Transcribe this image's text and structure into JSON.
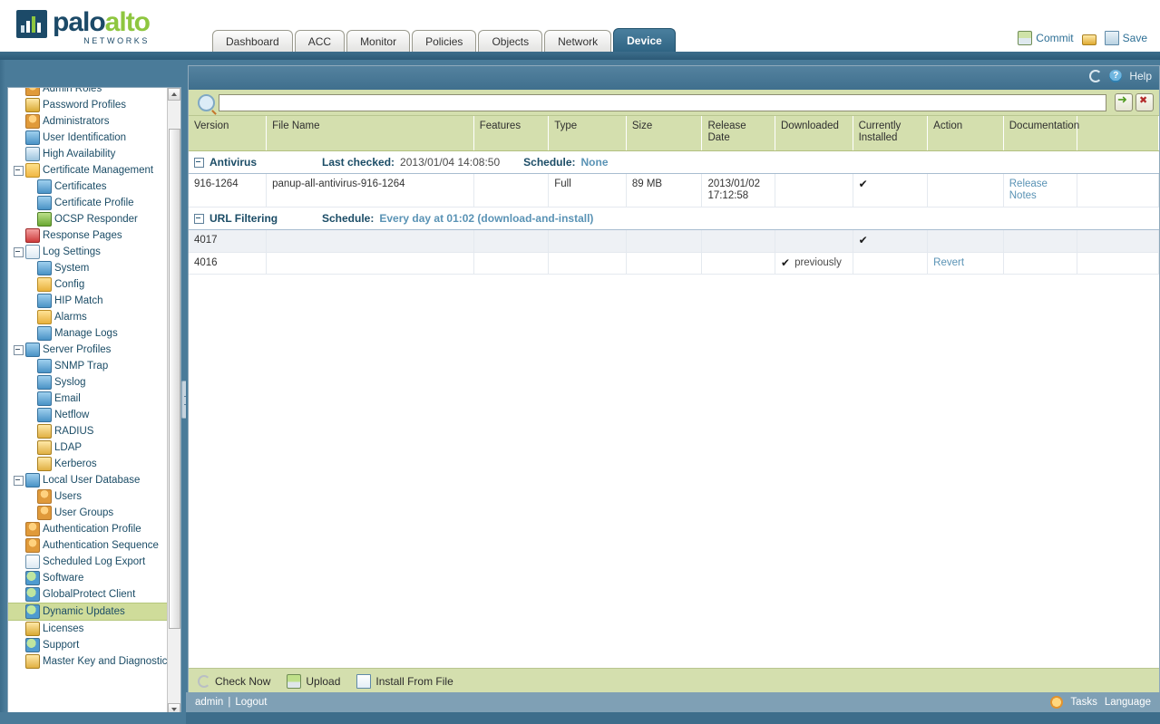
{
  "brand": {
    "name_part1": "palo",
    "name_part2": "alto",
    "tagline": "NETWORKS"
  },
  "tabs": [
    {
      "label": "Dashboard",
      "active": false
    },
    {
      "label": "ACC",
      "active": false
    },
    {
      "label": "Monitor",
      "active": false
    },
    {
      "label": "Policies",
      "active": false
    },
    {
      "label": "Objects",
      "active": false
    },
    {
      "label": "Network",
      "active": false
    },
    {
      "label": "Device",
      "active": true
    }
  ],
  "header_actions": {
    "commit": "Commit",
    "save": "Save",
    "lock_icon": "padlock-icon"
  },
  "panel_topbar": {
    "refresh_icon": "refresh-icon",
    "help": "Help",
    "help_icon": "help-icon"
  },
  "search": {
    "value": "",
    "placeholder": "",
    "icon": "search-icon",
    "apply_icon": "green-arrow-icon",
    "clear_icon": "red-x-icon"
  },
  "sidebar": {
    "items": [
      {
        "label": "Admin Roles",
        "level": 1,
        "icon": "admin-roles-icon",
        "expander": false,
        "selected": false
      },
      {
        "label": "Password Profiles",
        "level": 1,
        "icon": "key-icon",
        "expander": false,
        "selected": false
      },
      {
        "label": "Administrators",
        "level": 1,
        "icon": "user-icon",
        "expander": false,
        "selected": false
      },
      {
        "label": "User Identification",
        "level": 1,
        "icon": "id-card-icon",
        "expander": false,
        "selected": false
      },
      {
        "label": "High Availability",
        "level": 1,
        "icon": "ha-icon",
        "expander": false,
        "selected": false
      },
      {
        "label": "Certificate Management",
        "level": 0,
        "icon": "folder-icon",
        "expander": true,
        "selected": false
      },
      {
        "label": "Certificates",
        "level": 2,
        "icon": "certificate-icon",
        "expander": false,
        "selected": false
      },
      {
        "label": "Certificate Profile",
        "level": 2,
        "icon": "certificate-icon",
        "expander": false,
        "selected": false
      },
      {
        "label": "OCSP Responder",
        "level": 2,
        "icon": "ocsp-icon",
        "expander": false,
        "selected": false
      },
      {
        "label": "Response Pages",
        "level": 1,
        "icon": "response-pages-icon",
        "expander": false,
        "selected": false
      },
      {
        "label": "Log Settings",
        "level": 0,
        "icon": "log-settings-icon",
        "expander": true,
        "selected": false
      },
      {
        "label": "System",
        "level": 2,
        "icon": "system-log-icon",
        "expander": false,
        "selected": false
      },
      {
        "label": "Config",
        "level": 2,
        "icon": "config-log-icon",
        "expander": false,
        "selected": false
      },
      {
        "label": "HIP Match",
        "level": 2,
        "icon": "hip-match-icon",
        "expander": false,
        "selected": false
      },
      {
        "label": "Alarms",
        "level": 2,
        "icon": "alarms-icon",
        "expander": false,
        "selected": false
      },
      {
        "label": "Manage Logs",
        "level": 2,
        "icon": "manage-logs-icon",
        "expander": false,
        "selected": false
      },
      {
        "label": "Server Profiles",
        "level": 0,
        "icon": "server-profiles-icon",
        "expander": true,
        "selected": false
      },
      {
        "label": "SNMP Trap",
        "level": 2,
        "icon": "snmp-trap-icon",
        "expander": false,
        "selected": false
      },
      {
        "label": "Syslog",
        "level": 2,
        "icon": "syslog-icon",
        "expander": false,
        "selected": false
      },
      {
        "label": "Email",
        "level": 2,
        "icon": "email-icon",
        "expander": false,
        "selected": false
      },
      {
        "label": "Netflow",
        "level": 2,
        "icon": "netflow-icon",
        "expander": false,
        "selected": false
      },
      {
        "label": "RADIUS",
        "level": 2,
        "icon": "radius-icon",
        "expander": false,
        "selected": false
      },
      {
        "label": "LDAP",
        "level": 2,
        "icon": "ldap-icon",
        "expander": false,
        "selected": false
      },
      {
        "label": "Kerberos",
        "level": 2,
        "icon": "kerberos-icon",
        "expander": false,
        "selected": false
      },
      {
        "label": "Local User Database",
        "level": 0,
        "icon": "local-user-db-icon",
        "expander": true,
        "selected": false
      },
      {
        "label": "Users",
        "level": 2,
        "icon": "users-icon",
        "expander": false,
        "selected": false
      },
      {
        "label": "User Groups",
        "level": 2,
        "icon": "user-groups-icon",
        "expander": false,
        "selected": false
      },
      {
        "label": "Authentication Profile",
        "level": 1,
        "icon": "auth-profile-icon",
        "expander": false,
        "selected": false
      },
      {
        "label": "Authentication Sequence",
        "level": 1,
        "icon": "auth-sequence-icon",
        "expander": false,
        "selected": false
      },
      {
        "label": "Scheduled Log Export",
        "level": 1,
        "icon": "scheduled-log-export-icon",
        "expander": false,
        "selected": false
      },
      {
        "label": "Software",
        "level": 1,
        "icon": "software-icon",
        "expander": false,
        "selected": false
      },
      {
        "label": "GlobalProtect Client",
        "level": 1,
        "icon": "globalprotect-icon",
        "expander": false,
        "selected": false
      },
      {
        "label": "Dynamic Updates",
        "level": 1,
        "icon": "dynamic-updates-icon",
        "expander": false,
        "selected": true
      },
      {
        "label": "Licenses",
        "level": 1,
        "icon": "licenses-key-icon",
        "expander": false,
        "selected": false
      },
      {
        "label": "Support",
        "level": 1,
        "icon": "support-icon",
        "expander": false,
        "selected": false
      },
      {
        "label": "Master Key and Diagnostics",
        "level": 1,
        "icon": "master-key-icon",
        "expander": false,
        "selected": false
      }
    ]
  },
  "table": {
    "columns": [
      "Version",
      "File Name",
      "Features",
      "Type",
      "Size",
      "Release Date",
      "Downloaded",
      "Currently Installed",
      "Action",
      "Documentation",
      ""
    ],
    "groups": [
      {
        "name": "Antivirus",
        "last_checked_label": "Last checked:",
        "last_checked_value": "2013/01/04 14:08:50",
        "schedule_label": "Schedule:",
        "schedule_value": "None",
        "rows": [
          {
            "version": "916-1264",
            "file_name": "panup-all-antivirus-916-1264",
            "features": "",
            "type": "Full",
            "size": "89 MB",
            "release_date": "2013/01/02 17:12:58",
            "downloaded": "",
            "currently_installed": "✔",
            "action": "",
            "documentation": "Release Notes",
            "alt": false
          }
        ]
      },
      {
        "name": "URL Filtering",
        "last_checked_label": "",
        "last_checked_value": "",
        "schedule_label": "Schedule:",
        "schedule_value": "Every day at 01:02 (download-and-install)",
        "rows": [
          {
            "version": "4017",
            "file_name": "",
            "features": "",
            "type": "",
            "size": "",
            "release_date": "",
            "downloaded": "",
            "currently_installed": "✔",
            "action": "",
            "documentation": "",
            "alt": true
          },
          {
            "version": "4016",
            "file_name": "",
            "features": "",
            "type": "",
            "size": "",
            "release_date": "",
            "downloaded": "previously",
            "downloaded_check": "✔",
            "currently_installed": "",
            "action": "Revert",
            "documentation": "",
            "alt": false
          }
        ]
      }
    ]
  },
  "bottom_actions": [
    {
      "label": "Check Now",
      "icon": "refresh-icon"
    },
    {
      "label": "Upload",
      "icon": "upload-icon"
    },
    {
      "label": "Install From File",
      "icon": "document-icon"
    }
  ],
  "statusbar": {
    "user": "admin",
    "separator": "|",
    "logout": "Logout",
    "tasks": "Tasks",
    "language": "Language",
    "tasks_icon": "tasks-icon"
  },
  "colors": {
    "brand_blue": "#1c4a68",
    "brand_green": "#8ec63f",
    "header_band": "#3d6d8b",
    "table_header": "#d4dfae",
    "selected_nav": "#cfdc9a",
    "link": "#5a93b5"
  }
}
